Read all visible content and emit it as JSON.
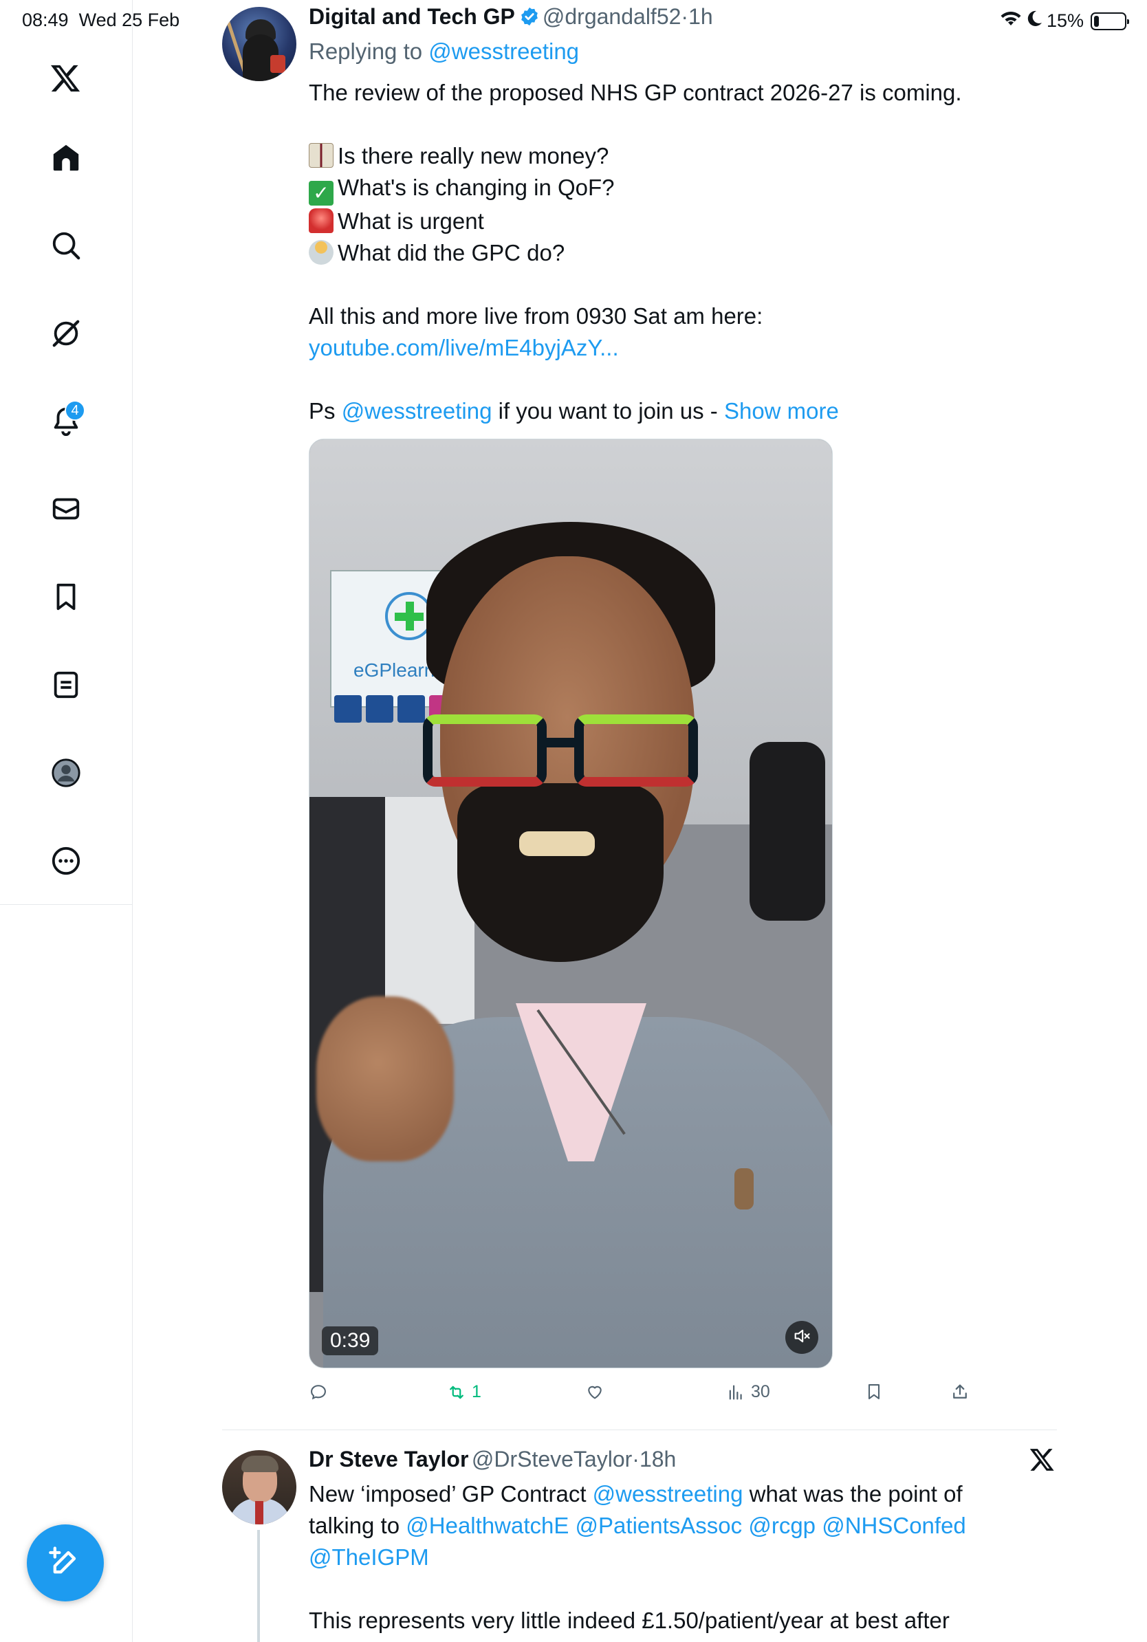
{
  "status_bar": {
    "time": "08:49",
    "date": "Wed 25 Feb",
    "battery": "15%",
    "battery_level": 0.15
  },
  "sidebar": {
    "items": [
      {
        "name": "x-logo",
        "icon": "x-logo-icon"
      },
      {
        "name": "home",
        "icon": "home-icon"
      },
      {
        "name": "search",
        "icon": "search-icon"
      },
      {
        "name": "grok",
        "icon": "grok-icon"
      },
      {
        "name": "notifications",
        "icon": "bell-icon",
        "badge": "4"
      },
      {
        "name": "messages",
        "icon": "mail-icon"
      },
      {
        "name": "bookmarks",
        "icon": "bookmark-icon"
      },
      {
        "name": "lists",
        "icon": "list-icon"
      },
      {
        "name": "profile",
        "icon": "profile-icon"
      },
      {
        "name": "more",
        "icon": "more-icon"
      }
    ],
    "compose_icon": "compose-icon"
  },
  "tweet1": {
    "author_name": "Digital and Tech GP",
    "handle": "@drgandalf52",
    "sep": "·",
    "time": "1h",
    "replying_prefix": "Replying to",
    "replying_to": "@wesstreeting",
    "line1": "The review of the proposed NHS GP contract 2026-27 is coming.",
    "bullets": [
      "Is there really new money?",
      "What's is changing in QoF?",
      "What is urgent",
      "What did the GPC do?"
    ],
    "live_prefix": "All this and more live from 0930 Sat am here:",
    "live_link": "youtube.com/live/mE4byjAzY...",
    "ps_prefix": "Ps",
    "ps_mention": "@wesstreeting",
    "ps_suffix": "if you want to join us -",
    "show_more": "Show more",
    "video_duration": "0:39",
    "video_poster_text": "eGPlearn",
    "actions": {
      "retweets": "1",
      "views": "30"
    }
  },
  "tweet2": {
    "author_name": "Dr Steve Taylor",
    "handle": "@DrSteveTaylor",
    "sep": "·",
    "time": "18h",
    "text_prefix": "New ‘imposed’ GP Contract",
    "mention1": "@wesstreeting",
    "text_mid": "what was the point of talking to",
    "mention2": "@HealthwatchE",
    "mention3": "@PatientsAssoc",
    "mention4": "@rcgp",
    "mention5": "@NHSConfed",
    "mention6": "@TheIGPM",
    "line2": "This represents very little indeed £1.50/patient/year at best after"
  },
  "colors": {
    "accent": "#1d9bf0",
    "text": "#0f1419",
    "muted": "#536471",
    "retweet_green": "#00ba7c"
  }
}
